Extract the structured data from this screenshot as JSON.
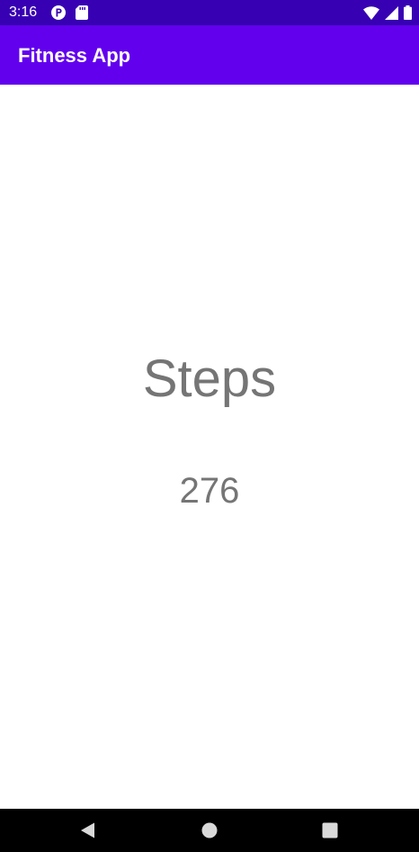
{
  "status_bar": {
    "time": "3:16",
    "background_color": "#3700b3",
    "left_icons": [
      "badge-p-icon",
      "sd-card-icon"
    ],
    "right_icons": [
      "wifi-icon",
      "signal-icon",
      "battery-icon"
    ]
  },
  "app_bar": {
    "title": "Fitness App",
    "background_color": "#6200ee"
  },
  "main": {
    "steps_label": "Steps",
    "steps_value": "276"
  },
  "nav_bar": {
    "buttons": [
      "back-icon",
      "home-icon",
      "recents-icon"
    ]
  }
}
